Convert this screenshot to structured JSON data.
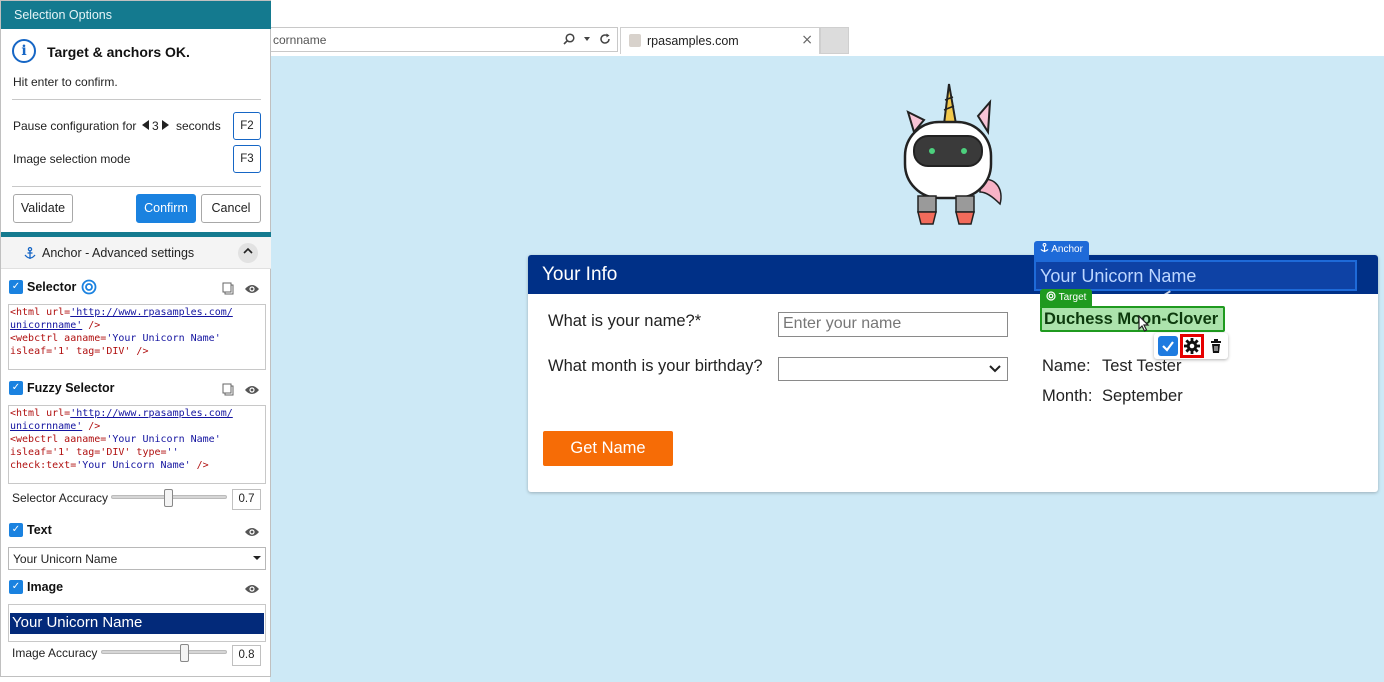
{
  "browser": {
    "address_text": "cornname",
    "tab_title": "rpasamples.com",
    "tab_close": "×"
  },
  "page": {
    "card_title": "Your Info",
    "name_label": "What is your name?*",
    "name_placeholder": "Enter your name",
    "month_label": "What month is your birthday?",
    "month_value": "",
    "get_name_button": "Get Name",
    "result_name_label": "Name:",
    "result_name_value": "Test Tester",
    "result_month_label": "Month:",
    "result_month_value": "September"
  },
  "overlay": {
    "anchor_tag": "Anchor",
    "anchor_text": "Your Unicorn Name",
    "target_tag": "Target",
    "target_text": "Duchess Moon-Clover"
  },
  "panel": {
    "header_title": "Selection Options",
    "status_title": "Target & anchors OK.",
    "status_hint": "Hit enter to confirm.",
    "pause_label": "Pause configuration for",
    "pause_value": "3",
    "pause_unit": "seconds",
    "pause_key": "F2",
    "image_mode_label": "Image selection mode",
    "image_mode_key": "F3",
    "validate_button": "Validate",
    "confirm_button": "Confirm",
    "cancel_button": "Cancel",
    "advanced_title": "Anchor - Advanced settings",
    "selector_title": "Selector",
    "selector_code": {
      "l1_open": "<html url=",
      "l1_url": "'http://www.rpasamples.com/",
      "l2_url": "unicornname'",
      "l2_close": " />",
      "l3_tag": "<webctrl aaname=",
      "l3_val": "'Your Unicorn Name'",
      "l4_attr": "isleaf='1' tag='DIV' />"
    },
    "fuzzy_title": "Fuzzy Selector",
    "fuzzy_code": {
      "l1_open": "<html url=",
      "l1_url": "'http://www.rpasamples.com/",
      "l2_url": "unicornname'",
      "l2_close": " />",
      "l3_tag": "<webctrl aaname=",
      "l3_val": "'Your Unicorn Name'",
      "l4_attr": "isleaf='1' tag='DIV' type=",
      "l4_val": "''",
      "l5_attr": "check:text=",
      "l5_val": "'Your Unicorn Name'",
      "l5_close": " />"
    },
    "selector_accuracy_label": "Selector Accuracy",
    "selector_accuracy_value": "0.7",
    "text_title": "Text",
    "text_value": "Your Unicorn Name",
    "image_title": "Image",
    "image_preview_text": "Your Unicorn Name",
    "image_accuracy_label": "Image Accuracy",
    "image_accuracy_value": "0.8"
  },
  "colors": {
    "panel_header": "#147a8f",
    "page_background": "#cde9f6",
    "card_header": "#003087",
    "primary_button": "#1a82e0",
    "get_name_button": "#f66c06",
    "anchor": "#1e6ad8",
    "target": "#1f9a1f",
    "highlight": "#e60000"
  },
  "icons": {
    "info": "info-icon",
    "anchor": "anchor-icon",
    "target": "target-icon",
    "eye": "eye-icon",
    "copy": "copy-icon",
    "gear": "gear-icon",
    "trash": "trash-icon",
    "check": "check-icon",
    "search": "search-icon",
    "refresh": "refresh-icon"
  }
}
